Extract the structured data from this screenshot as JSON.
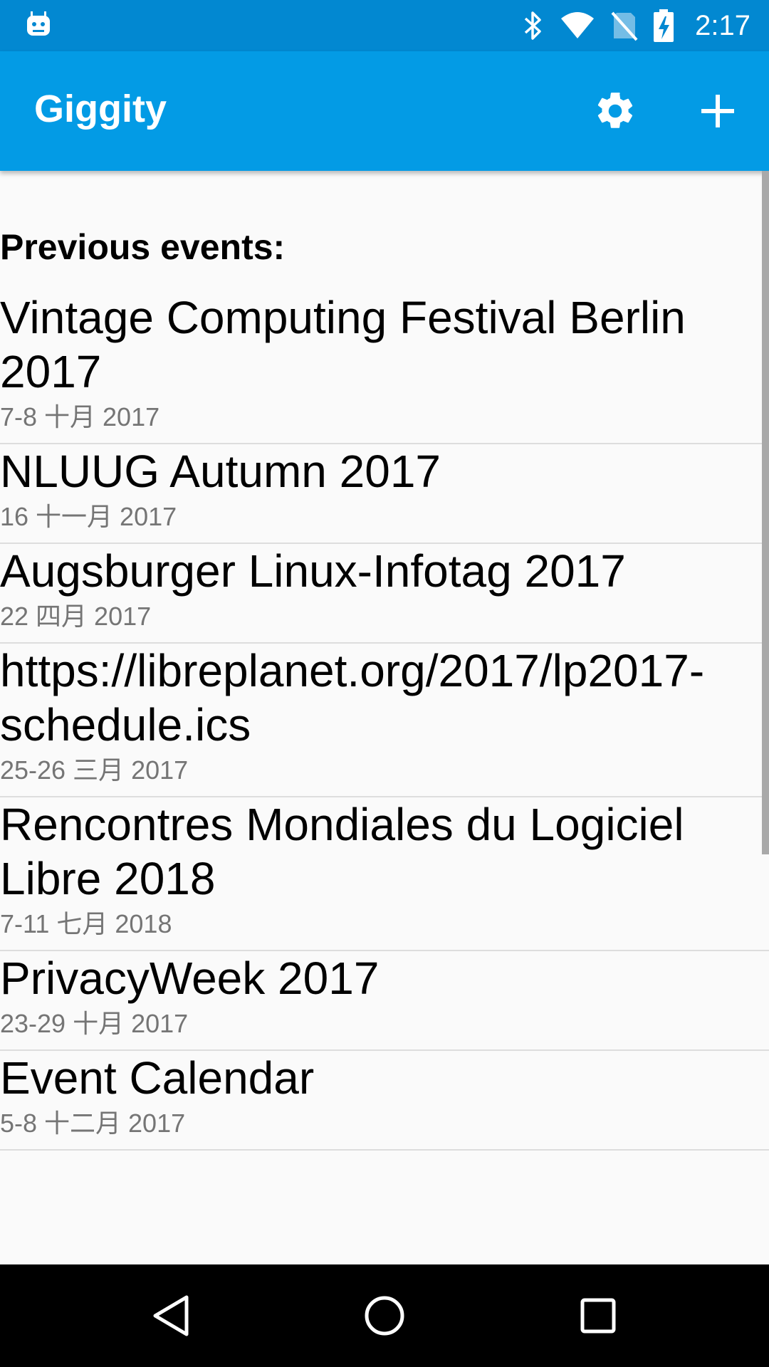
{
  "status_bar": {
    "time": "2:17",
    "icons": [
      "android-icon",
      "bluetooth-icon",
      "wifi-icon",
      "no-sim-icon",
      "battery-charging-icon"
    ]
  },
  "app_bar": {
    "title": "Giggity",
    "actions": [
      "gear-icon",
      "plus-icon"
    ]
  },
  "section_header": "Previous events:",
  "events": [
    {
      "title": "Vintage Computing Festival Berlin 2017",
      "date": "7-8 十月 2017"
    },
    {
      "title": "NLUUG Autumn 2017",
      "date": "16 十一月 2017"
    },
    {
      "title": "Augsburger Linux-Infotag 2017",
      "date": "22 四月 2017"
    },
    {
      "title": "https://libreplanet.org/2017/lp2017-schedule.ics",
      "date": "25-26 三月 2017"
    },
    {
      "title": "Rencontres Mondiales du Logiciel Libre 2018",
      "date": "7-11 七月 2018"
    },
    {
      "title": "PrivacyWeek 2017",
      "date": "23-29 十月 2017"
    },
    {
      "title": "Event Calendar",
      "date": "5-8 十二月 2017"
    }
  ],
  "nav_bar": {
    "buttons": [
      "back-icon",
      "home-icon",
      "recents-icon"
    ]
  },
  "colors": {
    "status_bar": "#0288d1",
    "app_bar": "#039be5",
    "background": "#fafafa",
    "divider": "#dddddd",
    "secondary_text": "#757575"
  }
}
